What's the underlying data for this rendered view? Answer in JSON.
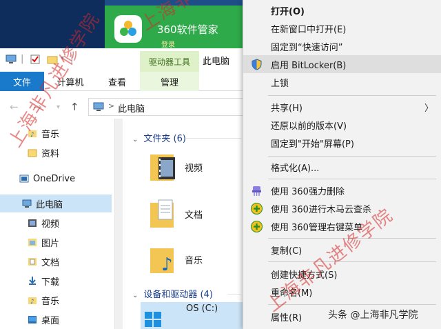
{
  "banner": {
    "title": "360软件管家",
    "subtitle": "登录"
  },
  "context_tab_group": "驱动器工具",
  "window_title": "此电脑",
  "ribbon_tabs": [
    "文件",
    "计算机",
    "查看",
    "管理"
  ],
  "address": {
    "path": "此电脑",
    "separator": ">"
  },
  "nav_pane": {
    "items": [
      {
        "label": "音乐",
        "icon": "music-folder-icon"
      },
      {
        "label": "资料",
        "icon": "folder-icon"
      },
      {
        "label": "OneDrive",
        "icon": "onedrive-icon"
      },
      {
        "label": "此电脑",
        "icon": "pc-icon",
        "selected": true
      },
      {
        "label": "视频",
        "icon": "video-folder-icon"
      },
      {
        "label": "图片",
        "icon": "pictures-folder-icon"
      },
      {
        "label": "文档",
        "icon": "documents-folder-icon"
      },
      {
        "label": "下载",
        "icon": "downloads-folder-icon"
      },
      {
        "label": "音乐",
        "icon": "music-folder-icon"
      },
      {
        "label": "桌面",
        "icon": "desktop-folder-icon"
      }
    ]
  },
  "content": {
    "folders_header": "文件夹 (6)",
    "folders": [
      {
        "label": "视频",
        "icon": "video-folder-icon"
      },
      {
        "label": "文档",
        "icon": "documents-folder-icon"
      },
      {
        "label": "音乐",
        "icon": "music-folder-icon"
      }
    ],
    "devices_header": "设备和驱动器 (4)",
    "drive_label": "OS (C:)"
  },
  "context_menu": {
    "items": [
      {
        "label": "打开(O)",
        "bold": true
      },
      {
        "label": "在新窗口中打开(E)"
      },
      {
        "label": "固定到“快速访问”"
      },
      {
        "label": "启用 BitLocker(B)",
        "icon": "shield-icon",
        "hover": true
      },
      {
        "label": "上锁"
      },
      {
        "label": "共享(H)",
        "submenu": true
      },
      {
        "label": "还原以前的版本(V)"
      },
      {
        "label": "固定到\"开始\"屏幕(P)"
      },
      {
        "label": "格式化(A)..."
      },
      {
        "label": "使用 360强力删除",
        "icon": "shredder-icon"
      },
      {
        "label": "使用 360进行木马云查杀",
        "icon": "360-plus-icon"
      },
      {
        "label": "使用 360管理右键菜单",
        "icon": "360-plus-icon"
      },
      {
        "label": "复制(C)"
      },
      {
        "label": "创建快捷方式(S)"
      },
      {
        "label": "重命名(M)"
      },
      {
        "label": "属性(R)"
      }
    ]
  },
  "watermark": "上海非凡进修学院",
  "credit": "头条 @上海非凡学院",
  "colors": {
    "file_tab": "#1979ca",
    "selection": "#cce4f7",
    "drive_tools": "#dff1c9",
    "banner_green": "#2eaa4a"
  }
}
